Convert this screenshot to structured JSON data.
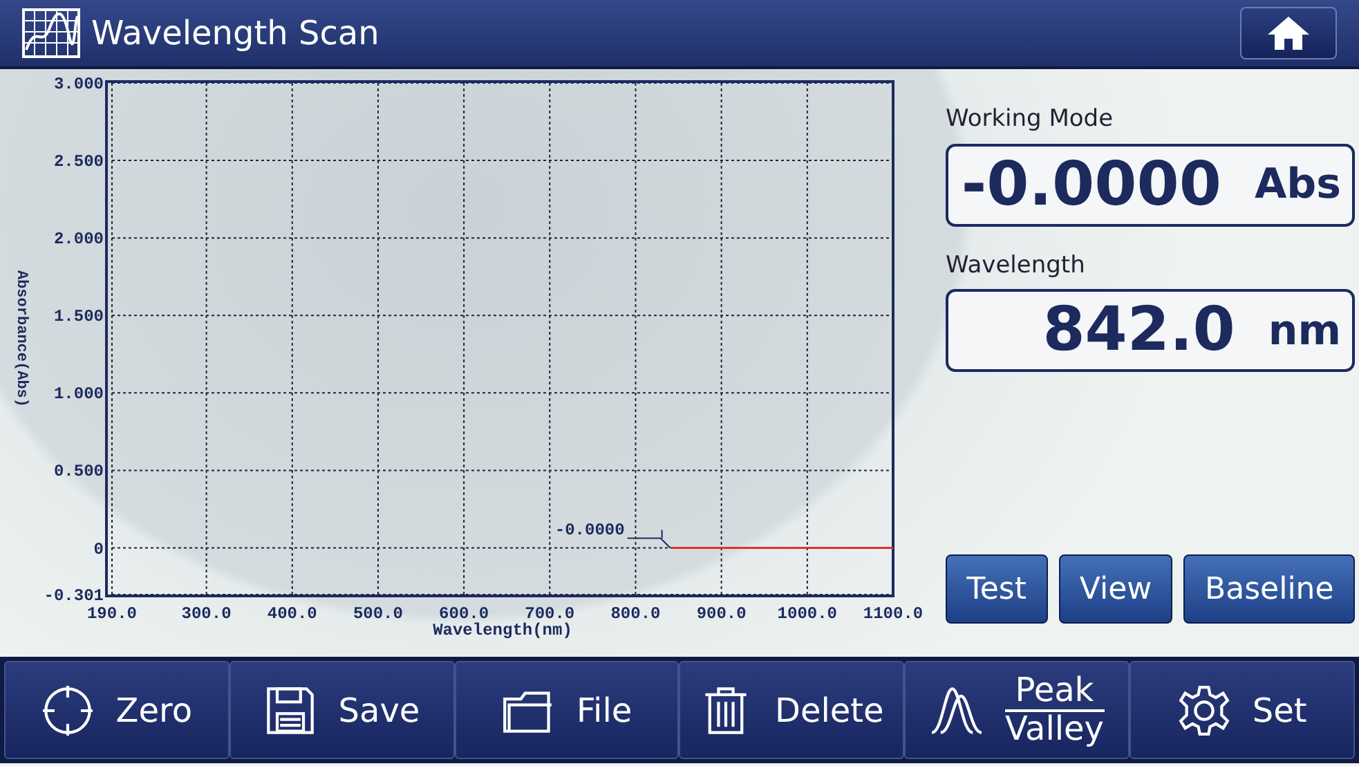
{
  "header": {
    "title": "Wavelength Scan"
  },
  "chart": {
    "chart_data": {
      "type": "line",
      "xlabel": "Wavelength(nm)",
      "ylabel": "Absorbance(Abs)",
      "xlim": [
        190,
        1100
      ],
      "ylim": [
        -0.301,
        3.0
      ],
      "xticks": [
        {
          "value": 190,
          "label": "190.0"
        },
        {
          "value": 300,
          "label": "300.0"
        },
        {
          "value": 400,
          "label": "400.0"
        },
        {
          "value": 500,
          "label": "500.0"
        },
        {
          "value": 600,
          "label": "600.0"
        },
        {
          "value": 700,
          "label": "700.0"
        },
        {
          "value": 800,
          "label": "800.0"
        },
        {
          "value": 900,
          "label": "900.0"
        },
        {
          "value": 1000,
          "label": "1000.0"
        },
        {
          "value": 1100,
          "label": "1100.0"
        }
      ],
      "yticks": [
        {
          "value": -0.301,
          "label": "-0.301"
        },
        {
          "value": 0,
          "label": "0"
        },
        {
          "value": 0.5,
          "label": "0.500"
        },
        {
          "value": 1,
          "label": "1.000"
        },
        {
          "value": 1.5,
          "label": "1.500"
        },
        {
          "value": 2,
          "label": "2.000"
        },
        {
          "value": 2.5,
          "label": "2.500"
        },
        {
          "value": 3,
          "label": "3.000"
        }
      ],
      "x": [
        842,
        1100
      ],
      "grid": true,
      "series": [
        {
          "color": "#e03030",
          "values": [
            0,
            0
          ]
        }
      ],
      "annotations": [
        {
          "x": 842,
          "y": 0,
          "text": "-0.0000"
        }
      ]
    }
  },
  "readouts": [
    {
      "label": "Working Mode",
      "value": "-0.0000",
      "unit": "Abs"
    },
    {
      "label": "Wavelength",
      "value": "842.0",
      "unit": "nm"
    }
  ],
  "actions": [
    "Test",
    "View",
    "Baseline"
  ],
  "toolbar": [
    {
      "lines": [
        "Zero"
      ]
    },
    {
      "lines": [
        "Save"
      ]
    },
    {
      "lines": [
        "File"
      ]
    },
    {
      "lines": [
        "Delete"
      ]
    },
    {
      "lines": [
        "Peak",
        "Valley"
      ]
    },
    {
      "lines": [
        "Set"
      ]
    }
  ]
}
